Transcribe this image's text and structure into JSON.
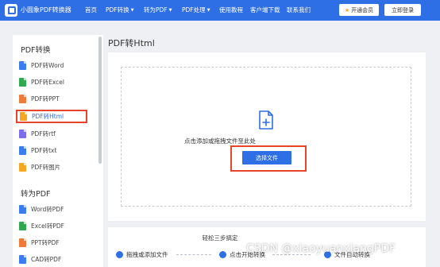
{
  "header": {
    "brand": "小圆象PDF转换器",
    "nav": [
      "首页",
      "PDF转换",
      "转为PDF",
      "PDF处理",
      "使用教程",
      "客户端下载",
      "联系我们"
    ],
    "vip_button": "开通会员",
    "login_button": "立即登录"
  },
  "sidebar": {
    "section1_title": "PDF转换",
    "section1_items": [
      "PDF转Word",
      "PDF转Excel",
      "PDF转PPT",
      "PDF转Html",
      "PDF转rtf",
      "PDF转txt",
      "PDF转图片"
    ],
    "section2_title": "转为PDF",
    "section2_items": [
      "Word转PDF",
      "Excel转PDF",
      "PPT转PDF",
      "CAD转PDF"
    ],
    "active_item": "PDF转Html"
  },
  "main": {
    "title": "PDF转Html",
    "drop_hint": "点击添加或拖拽文件至此处",
    "select_button": "选择文件"
  },
  "steps": {
    "title": "轻松三步搞定",
    "items": [
      "拖拽或添加文件",
      "点击开始转换",
      "文件自动转换"
    ]
  },
  "watermark": "CSDN @xiaoyuanxiangPDF",
  "colors": {
    "brand_blue": "#2f6fe5",
    "highlight_red": "#e8432b",
    "vip_star": "#f5a623"
  }
}
